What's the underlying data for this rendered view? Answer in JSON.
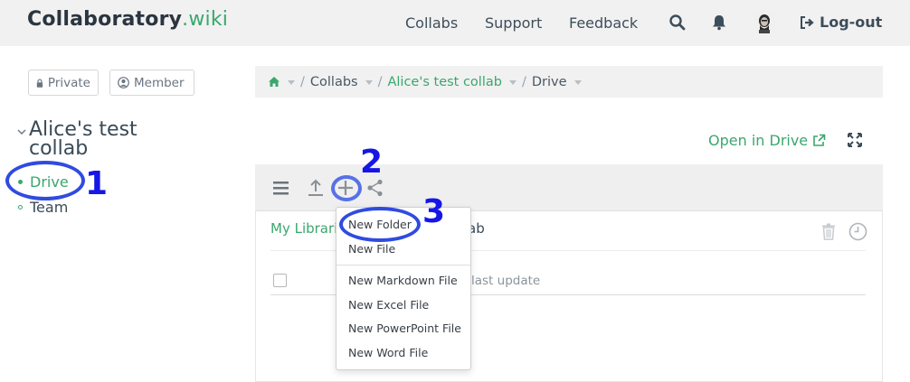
{
  "header": {
    "brand_main": "Collaboratory",
    "brand_suffix": ".wiki",
    "nav": [
      "Collabs",
      "Support",
      "Feedback"
    ],
    "logout_label": "Log-out"
  },
  "sidebar": {
    "visibility_private": "Private",
    "visibility_member": "Member",
    "project_title": "Alice's test collab",
    "items": [
      {
        "label": "Drive",
        "active": true
      },
      {
        "label": "Team",
        "active": false
      }
    ]
  },
  "breadcrumb": {
    "items": [
      "Collabs",
      "Alice's test collab",
      "Drive"
    ]
  },
  "drive": {
    "open_in_drive_label": "Open in Drive",
    "library_label": "My Librari",
    "library_rest": "ab",
    "column_last_update": "last update"
  },
  "add_menu": {
    "items_top": [
      "New Folder",
      "New File"
    ],
    "items_bottom": [
      "New Markdown File",
      "New Excel File",
      "New PowerPoint File",
      "New Word File"
    ]
  },
  "annotations": {
    "step1": "1",
    "step2": "2",
    "step3": "3"
  },
  "colors": {
    "accent": "#3aa76d",
    "annotation": "#1616e6"
  }
}
